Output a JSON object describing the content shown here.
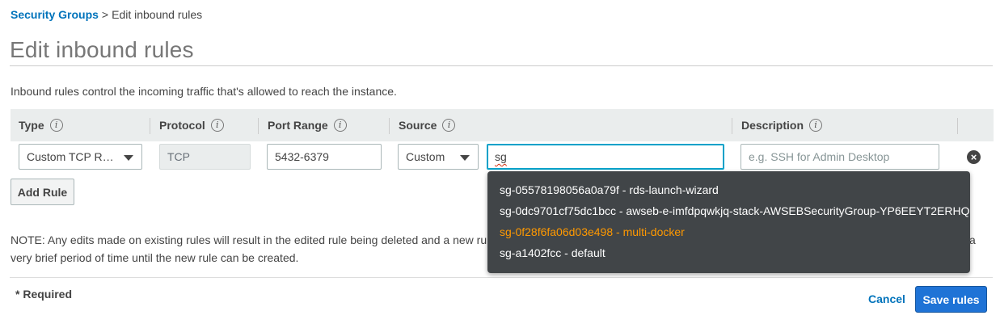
{
  "breadcrumb": {
    "parent": "Security Groups",
    "separator": ">",
    "current": "Edit inbound rules"
  },
  "page": {
    "title": "Edit inbound rules",
    "intro": "Inbound rules control the incoming traffic that's allowed to reach the instance."
  },
  "table": {
    "headers": {
      "type": "Type",
      "protocol": "Protocol",
      "port_range": "Port Range",
      "source": "Source",
      "description": "Description"
    },
    "info_glyph": "i",
    "row": {
      "type_value": "Custom TCP R…",
      "protocol_value": "TCP",
      "port_range_value": "5432-6379",
      "source_mode": "Custom",
      "source_query": "sg",
      "description_placeholder": "e.g. SSH for Admin Desktop",
      "remove_glyph": "×"
    }
  },
  "buttons": {
    "add_rule": "Add Rule",
    "cancel": "Cancel",
    "save": "Save rules"
  },
  "note": {
    "visible_line1": "NOTE: Any edits made on existing rules will result in the edited rule being deleted and a new rule",
    "visible_line2": "very brief period of time until the new rule can be created.",
    "right_fragment": "a"
  },
  "required_label": "* Required",
  "source_suggestions": [
    {
      "label": "sg-05578198056a0a79f - rds-launch-wizard",
      "highlighted": false
    },
    {
      "label": "sg-0dc9701cf75dc1bcc - awseb-e-imfdpqwkjq-stack-AWSEBSecurityGroup-YP6EEYT2ERHQ",
      "highlighted": false
    },
    {
      "label": "sg-0f28f6fa06d03e498 - multi-docker",
      "highlighted": true
    },
    {
      "label": "sg-a1402fcc - default",
      "highlighted": false
    }
  ],
  "colors": {
    "link": "#0073bb",
    "primary_button": "#1f73d6",
    "highlight": "#ff9900",
    "dropdown_bg": "#414548",
    "header_bg": "#eaeded",
    "focus": "#00a1c9"
  }
}
